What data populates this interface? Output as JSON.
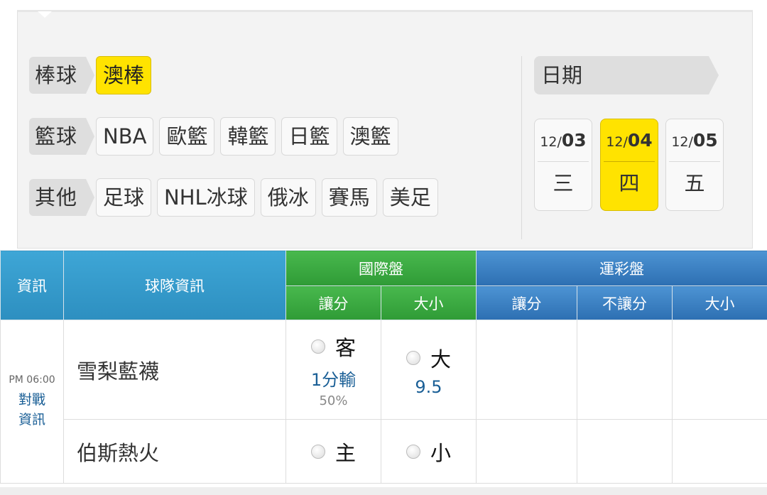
{
  "filters": {
    "baseball": {
      "label": "棒球",
      "items": [
        {
          "label": "澳棒",
          "active": true
        }
      ]
    },
    "basketball": {
      "label": "籃球",
      "items": [
        {
          "label": "NBA"
        },
        {
          "label": "歐籃"
        },
        {
          "label": "韓籃"
        },
        {
          "label": "日籃"
        },
        {
          "label": "澳籃"
        }
      ]
    },
    "other": {
      "label": "其他",
      "items": [
        {
          "label": "足球"
        },
        {
          "label": "NHL冰球"
        },
        {
          "label": "俄冰"
        },
        {
          "label": "賽馬"
        },
        {
          "label": "美足"
        }
      ]
    }
  },
  "date_picker": {
    "label": "日期",
    "days": [
      {
        "month": "12/",
        "day": "03",
        "weekday": "三",
        "active": false
      },
      {
        "month": "12/",
        "day": "04",
        "weekday": "四",
        "active": true
      },
      {
        "month": "12/",
        "day": "05",
        "weekday": "五",
        "active": false
      }
    ]
  },
  "table": {
    "headers": {
      "info": "資訊",
      "team_info": "球隊資訊",
      "intl": "國際盤",
      "intl_spread": "讓分",
      "intl_total": "大小",
      "lottery": "運彩盤",
      "lot_spread": "讓分",
      "lot_nospread": "不讓分",
      "lot_total": "大小"
    },
    "match": {
      "time": "PM 06:00",
      "matchup_link_1": "對戰",
      "matchup_link_2": "資訊",
      "away_team": "雪梨藍襪",
      "home_team": "伯斯熱火",
      "away_label": "客",
      "home_label": "主",
      "spread_line": "1分輸",
      "spread_pct": "50%",
      "over_label": "大",
      "under_label": "小",
      "total_line": "9.5"
    }
  }
}
